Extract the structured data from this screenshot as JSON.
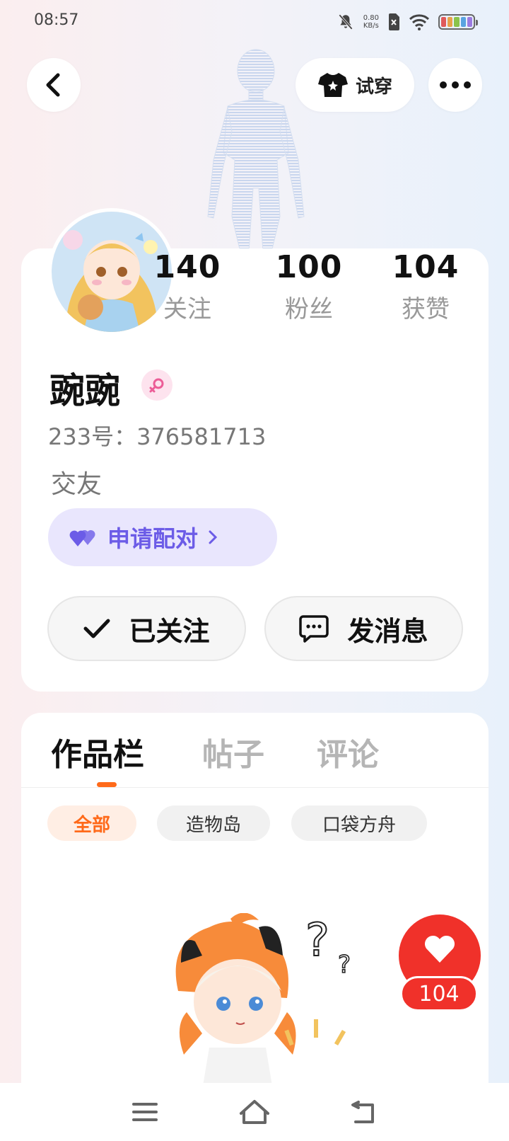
{
  "status_bar": {
    "time": "08:57",
    "net_speed_value": "0.80",
    "net_speed_unit": "KB/s",
    "icons": [
      "mute-bell-icon",
      "no-sim-icon",
      "wifi-icon",
      "battery-icon"
    ]
  },
  "top_bar": {
    "try_on_label": "试穿"
  },
  "profile": {
    "stats": [
      {
        "value": "140",
        "label": "关注"
      },
      {
        "value": "100",
        "label": "粉丝"
      },
      {
        "value": "104",
        "label": "获赞"
      }
    ],
    "name": "豌豌",
    "gender": "female",
    "id_text": "233号：376581713",
    "bio": "交友",
    "pair_label": "申请配对",
    "follow_label": "已关注",
    "message_label": "发消息"
  },
  "works": {
    "tabs": [
      {
        "label": "作品栏",
        "active": true
      },
      {
        "label": "帖子",
        "active": false
      },
      {
        "label": "评论",
        "active": false
      }
    ],
    "filters": [
      {
        "label": "全部",
        "active": true
      },
      {
        "label": "造物岛",
        "active": false
      },
      {
        "label": "口袋方舟",
        "active": false
      }
    ],
    "like_count": "104"
  },
  "colors": {
    "accent_orange": "#ff6a1a",
    "pair_purple": "#6c5ce7",
    "like_red": "#f0312a"
  }
}
